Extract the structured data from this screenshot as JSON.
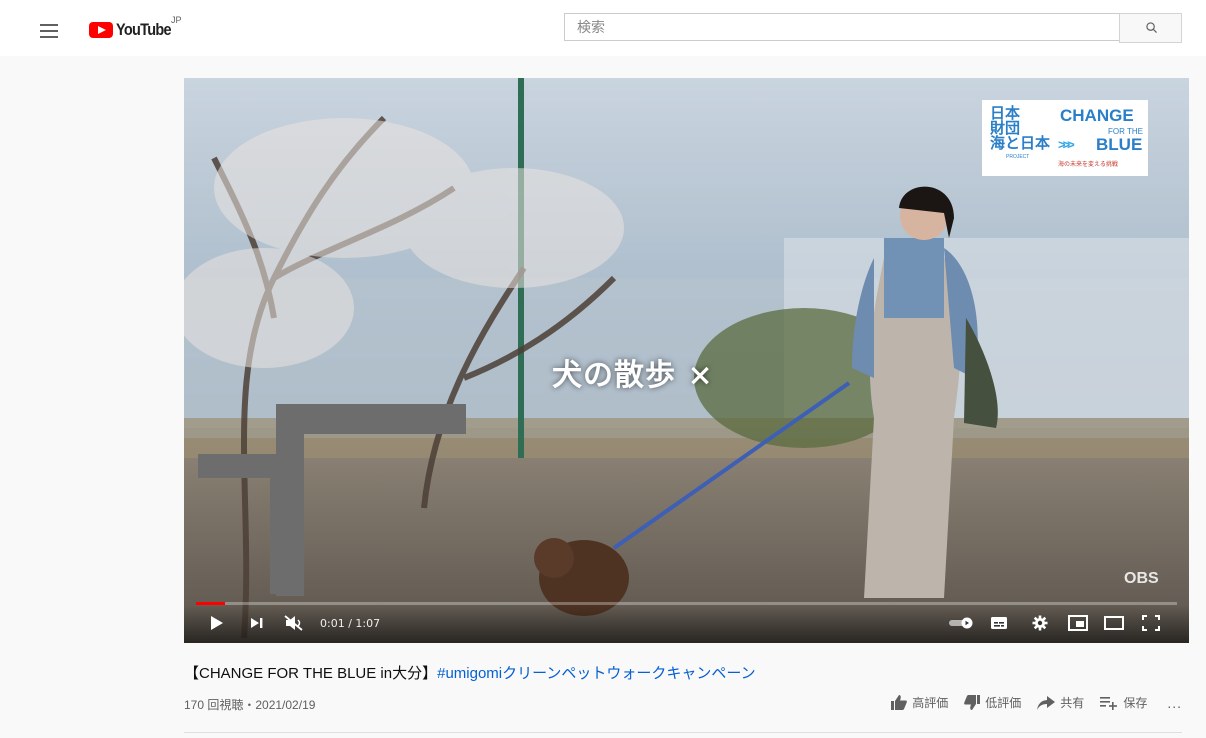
{
  "header": {
    "logo_text": "YouTube",
    "region": "JP",
    "search_placeholder": "検索"
  },
  "player": {
    "caption": "犬の散歩 ×",
    "watermark": "OBS",
    "brand": {
      "jp_top": "日本\n財団",
      "jp_bottom": "海と日本",
      "project": "PROJECT",
      "change": "CHANGE",
      "for_the": "FOR THE",
      "blue": "BLUE",
      "tagline": "海の未来を変える挑戦"
    },
    "time": "0:01 / 1:07",
    "progress": 0.03,
    "muted": true
  },
  "video": {
    "title_prefix": "【CHANGE FOR THE BLUE in大分】",
    "title_hashtag": "#umigomi",
    "title_suffix": "クリーンペットウォークキャンペーン",
    "meta": "170 回視聴・2021/02/19",
    "actions": {
      "like": "高評価",
      "dislike": "低評価",
      "share": "共有",
      "save": "保存",
      "more": "..."
    }
  },
  "colors": {
    "accent": "#ff0000",
    "link": "#065fd4"
  }
}
